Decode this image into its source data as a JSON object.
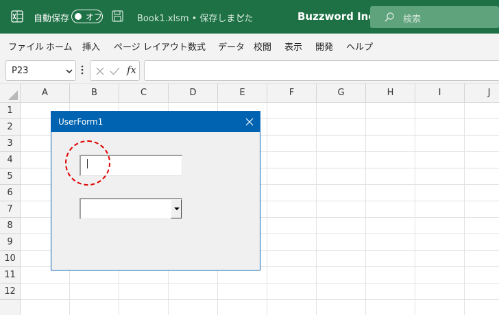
{
  "titlebar": {
    "autosave_label": "自動保存",
    "autosave_state": "オフ",
    "filename": "Book1.xlsm • 保存しました",
    "company": "Buzzword Inc.",
    "search_placeholder": "検索",
    "colors": {
      "background": "#1e7145",
      "search": "#5fa37d"
    },
    "icons": [
      "excel-logo-icon",
      "save-icon",
      "chevron-down-icon",
      "search-icon"
    ]
  },
  "menu": {
    "items": [
      "ファイル",
      "ホーム",
      "挿入",
      "ページ レイアウト",
      "数式",
      "データ",
      "校閲",
      "表示",
      "開発",
      "ヘルプ"
    ]
  },
  "formula_bar": {
    "namebox_value": "P23",
    "fx_label": "fx",
    "formula_value": "",
    "icons": [
      "cancel-icon",
      "enter-icon",
      "insert-function-icon"
    ]
  },
  "sheet": {
    "columns": [
      "A",
      "B",
      "C",
      "D",
      "E",
      "F",
      "G",
      "H",
      "I",
      "J"
    ],
    "rows": [
      "1",
      "2",
      "3",
      "4",
      "5",
      "6",
      "7",
      "8",
      "9",
      "10",
      "11",
      "12"
    ]
  },
  "userform": {
    "title": "UserForm1",
    "textbox_value": "",
    "combobox_value": "",
    "colors": {
      "titlebar": "#0063b1",
      "highlight": "#e00000"
    }
  }
}
